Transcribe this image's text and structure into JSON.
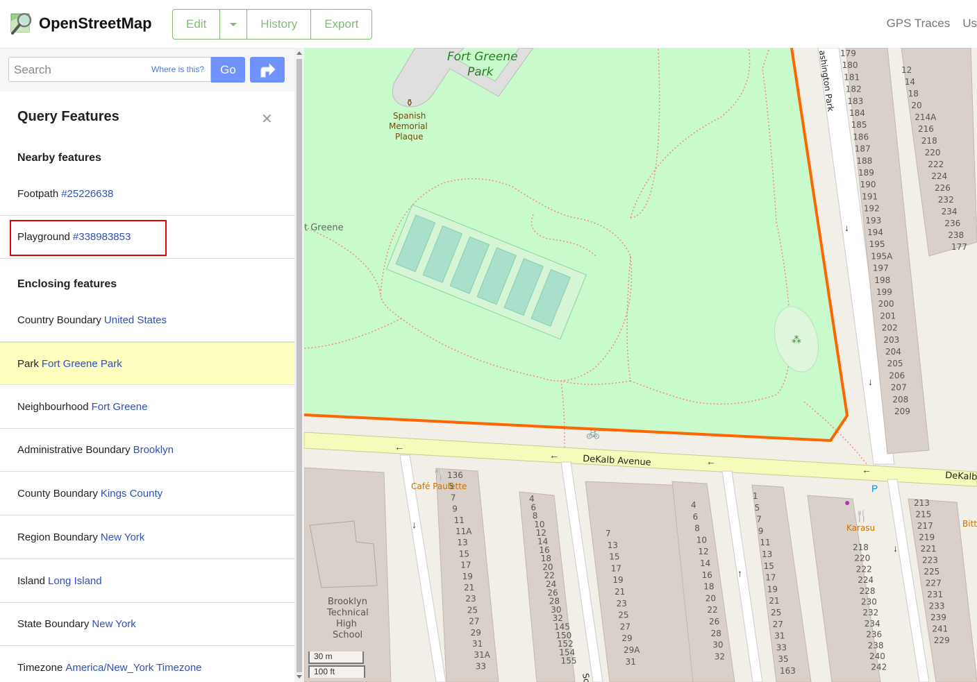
{
  "header": {
    "app_title": "OpenStreetMap",
    "edit_label": "Edit",
    "history_label": "History",
    "export_label": "Export",
    "gps_traces_label": "GPS Traces",
    "user_label": "Us"
  },
  "search": {
    "placeholder": "Search",
    "where_is_this": "Where is this?",
    "go_label": "Go"
  },
  "query_panel": {
    "title": "Query Features",
    "nearby_heading": "Nearby features",
    "enclosing_heading": "Enclosing features",
    "nearby": [
      {
        "type": "Footpath",
        "link": "#25226638"
      },
      {
        "type": "Playground",
        "link": "#338983853"
      }
    ],
    "enclosing": [
      {
        "type": "Country Boundary",
        "link": "United States"
      },
      {
        "type": "Park",
        "link": "Fort Greene Park"
      },
      {
        "type": "Neighbourhood",
        "link": "Fort Greene"
      },
      {
        "type": "Administrative Boundary",
        "link": "Brooklyn"
      },
      {
        "type": "County Boundary",
        "link": "Kings County"
      },
      {
        "type": "Region Boundary",
        "link": "New York"
      },
      {
        "type": "Island",
        "link": "Long Island"
      },
      {
        "type": "State Boundary",
        "link": "New York"
      },
      {
        "type": "Timezone",
        "link": "America/New_York Timezone"
      }
    ]
  },
  "map": {
    "park_name_1": "Fort Greene",
    "park_name_2": "Park",
    "plaque_1": "Spanish",
    "plaque_2": "Memorial",
    "plaque_3": "Plaque",
    "neighbourhood_label": "t Greene",
    "street_main": "DeKalb Avenue",
    "street_main_right": "DeKalb",
    "street_vertical": "ashington Park",
    "cafe_label": "Café Paulette",
    "karasu_label": "Karasu",
    "bitters_label": "Bitters",
    "school_1": "Brooklyn",
    "school_2": "Technical",
    "school_3": "High",
    "school_4": "School",
    "street_so": "So",
    "scale_metric": "30 m",
    "scale_imperial": "100 ft",
    "house_numbers_right": [
      "179",
      "180",
      "181",
      "182",
      "183",
      "184",
      "185",
      "186",
      "187",
      "188",
      "189",
      "190",
      "191",
      "192",
      "193",
      "194",
      "195",
      "195A",
      "197",
      "198",
      "199",
      "200",
      "201",
      "202",
      "203",
      "204",
      "205",
      "206",
      "207",
      "208",
      "209"
    ],
    "house_numbers_far_right": [
      "12",
      "14",
      "18",
      "20",
      "214A",
      "216",
      "218",
      "220",
      "222",
      "224",
      "226",
      "232",
      "234",
      "236",
      "238",
      "177"
    ],
    "house_numbers_left": [
      "136",
      "5",
      "7",
      "9",
      "11",
      "11A",
      "13",
      "15",
      "17",
      "19",
      "21",
      "23",
      "25",
      "27",
      "29",
      "31",
      "31A",
      "33"
    ],
    "house_numbers_mid": [
      "4",
      "6",
      "8",
      "10",
      "12",
      "14",
      "16",
      "18",
      "20",
      "22",
      "24",
      "26",
      "28",
      "30",
      "32",
      "145",
      "150",
      "152",
      "154",
      "155"
    ],
    "house_numbers_mid2": [
      "7",
      "13",
      "15",
      "17",
      "19",
      "21",
      "23",
      "25",
      "27",
      "29",
      "29A",
      "31"
    ],
    "house_numbers_mid3": [
      "4",
      "6",
      "8",
      "10",
      "12",
      "14",
      "16",
      "18",
      "20",
      "22",
      "26",
      "28",
      "30",
      "32"
    ],
    "house_numbers_r2": [
      "1",
      "5",
      "7",
      "9",
      "11",
      "13",
      "15",
      "17",
      "19",
      "21",
      "25",
      "27",
      "31",
      "33",
      "35",
      "163"
    ],
    "house_numbers_r3": [
      "218",
      "220",
      "222",
      "224",
      "228",
      "230",
      "232",
      "234",
      "236",
      "238",
      "240",
      "242"
    ],
    "house_numbers_r4": [
      "213",
      "215",
      "217",
      "219",
      "221",
      "223",
      "225",
      "227",
      "231",
      "233",
      "239",
      "241",
      "229"
    ]
  }
}
